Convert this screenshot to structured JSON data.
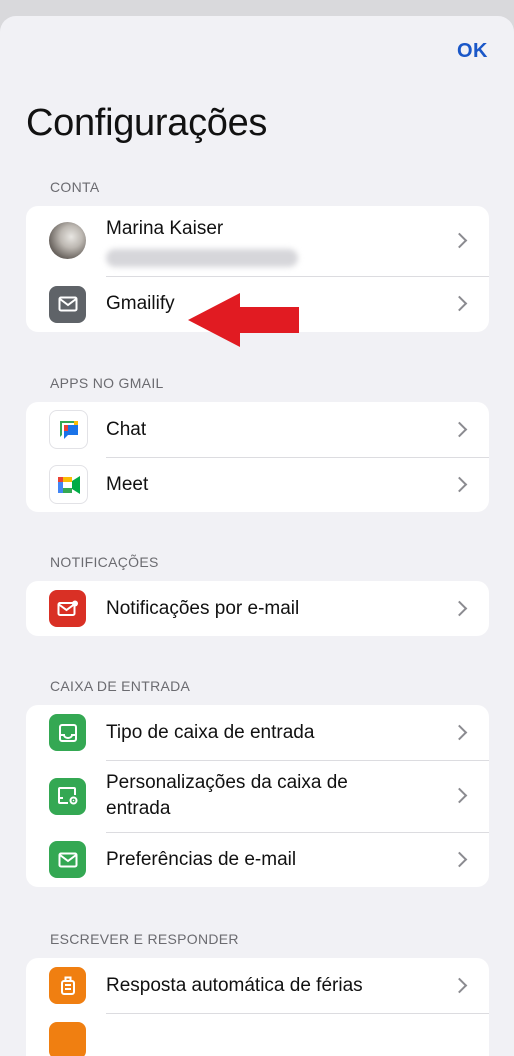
{
  "header": {
    "done_label": "OK",
    "title": "Configurações"
  },
  "sections": {
    "account": {
      "header": "CONTA",
      "user_name": "Marina Kaiser",
      "gmailify_label": "Gmailify"
    },
    "apps": {
      "header": "APPS NO GMAIL",
      "chat_label": "Chat",
      "meet_label": "Meet"
    },
    "notifications": {
      "header": "NOTIFICAÇÕES",
      "email_notifications_label": "Notificações por e-mail"
    },
    "inbox": {
      "header": "CAIXA DE ENTRADA",
      "inbox_type_label": "Tipo de caixa de entrada",
      "inbox_customizations_label": "Personalizações da caixa de entrada",
      "email_preferences_label": "Preferências de e-mail"
    },
    "compose": {
      "header": "ESCREVER E RESPONDER",
      "vacation_label": "Resposta automática de férias"
    }
  },
  "colors": {
    "accent": "#1a57c8",
    "annotation_arrow": "#e11b22",
    "gmailify_icon": "#5f6368",
    "notifications_icon": "#d93025",
    "inbox_icon": "#34a853",
    "compose_icon": "#f07f11"
  },
  "icons": {
    "gmailify": "mail-icon",
    "chat": "google-chat-icon",
    "meet": "google-meet-icon",
    "notifications": "mail-notification-icon",
    "inbox_type": "inbox-icon",
    "inbox_customizations": "inbox-settings-icon",
    "email_preferences": "mail-icon",
    "vacation": "luggage-icon",
    "row_navigation": "chevron-right-icon"
  }
}
